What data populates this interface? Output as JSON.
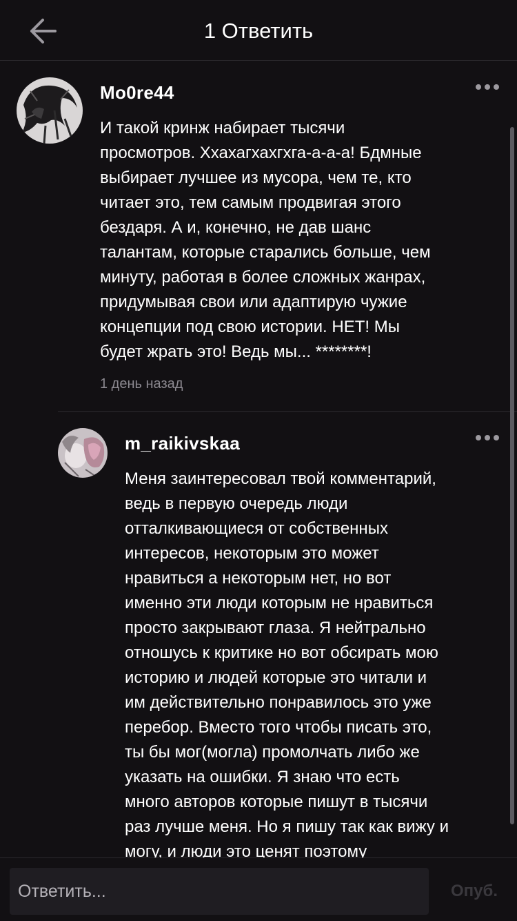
{
  "header": {
    "title": "1 Ответить",
    "back_icon": "arrow-left-icon"
  },
  "comments": [
    {
      "username": "Mo0re44",
      "avatar": "avatar-image",
      "text": "И такой кринж набирает тысячи\nпросмотров. Ххахагхахгхга-а-а-а!  Бдмные\nвыбирает лучшее из мусора, чем те, кто\nчитает это, тем самым продвигая  этого\nбездаря. А и, конечно, не дав шанс\nталантам, которые старались больше, чем\nминуту, работая в более сложных жанрах,\nпридумывая свои или адаптирую чужие\nконцепции под свою истории. НЕТ! Мы\nбудет жрать это! Ведь мы... ********!",
      "time": "1 день назад",
      "more_icon": "more-horizontal-icon"
    },
    {
      "username": "m_raikivskaa",
      "avatar": "avatar-image",
      "text": "Меня заинтересовал твой комментарий,\nведь в первую очередь люди\nотталкивающиеся от собственных\nинтересов, некоторым это может\nнравиться а некоторым нет, но вот\nименно эти люди которым не нравиться\nпросто закрывают глаза. Я нейтрально\nотношусь к критике но вот обсирать мою\nисторию и людей которые это читали и\nим действительно понравилось это уже\nперебор. Вместо того чтобы писать это,\nты бы мог(могла) промолчать либо же\nуказать на ошибки. Я знаю что есть\nмного авторов которые пишут в тысячи\nраз лучше меня. Но я пишу так как вижу и\nмогу, и люди это ценят поэтому",
      "more_icon": "more-horizontal-icon"
    }
  ],
  "reply_bar": {
    "placeholder": "Ответить...",
    "publish_label": "Опуб."
  }
}
